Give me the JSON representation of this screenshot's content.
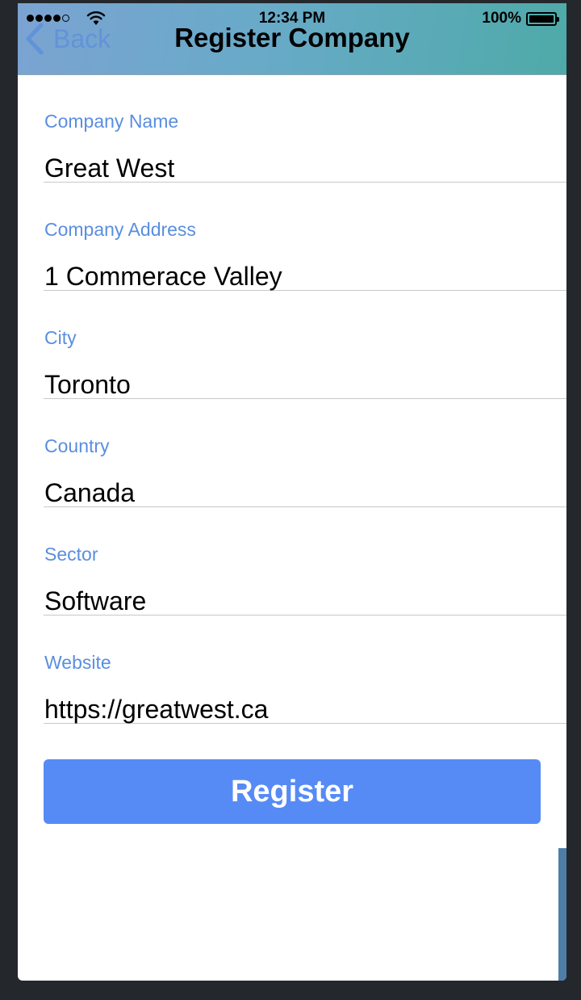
{
  "status_bar": {
    "time": "12:34 PM",
    "battery_percent": "100%",
    "battery_level": 1.0,
    "signal_bars": 4,
    "signal_max": 5
  },
  "nav": {
    "back_label": "Back",
    "title": "Register Company"
  },
  "form": {
    "fields": [
      {
        "label": "Company Name",
        "value": "Great West"
      },
      {
        "label": "Company Address",
        "value": "1 Commerace Valley"
      },
      {
        "label": "City",
        "value": "Toronto"
      },
      {
        "label": "Country",
        "value": "Canada"
      },
      {
        "label": "Sector",
        "value": "Software"
      },
      {
        "label": "Website",
        "value": "https://greatwest.ca"
      }
    ]
  },
  "actions": {
    "register_label": "Register"
  },
  "colors": {
    "accent": "#568bf5",
    "label": "#5a8ee0",
    "nav_gradient_start": "#7ba3d2",
    "nav_gradient_end": "#4eaaa8"
  }
}
